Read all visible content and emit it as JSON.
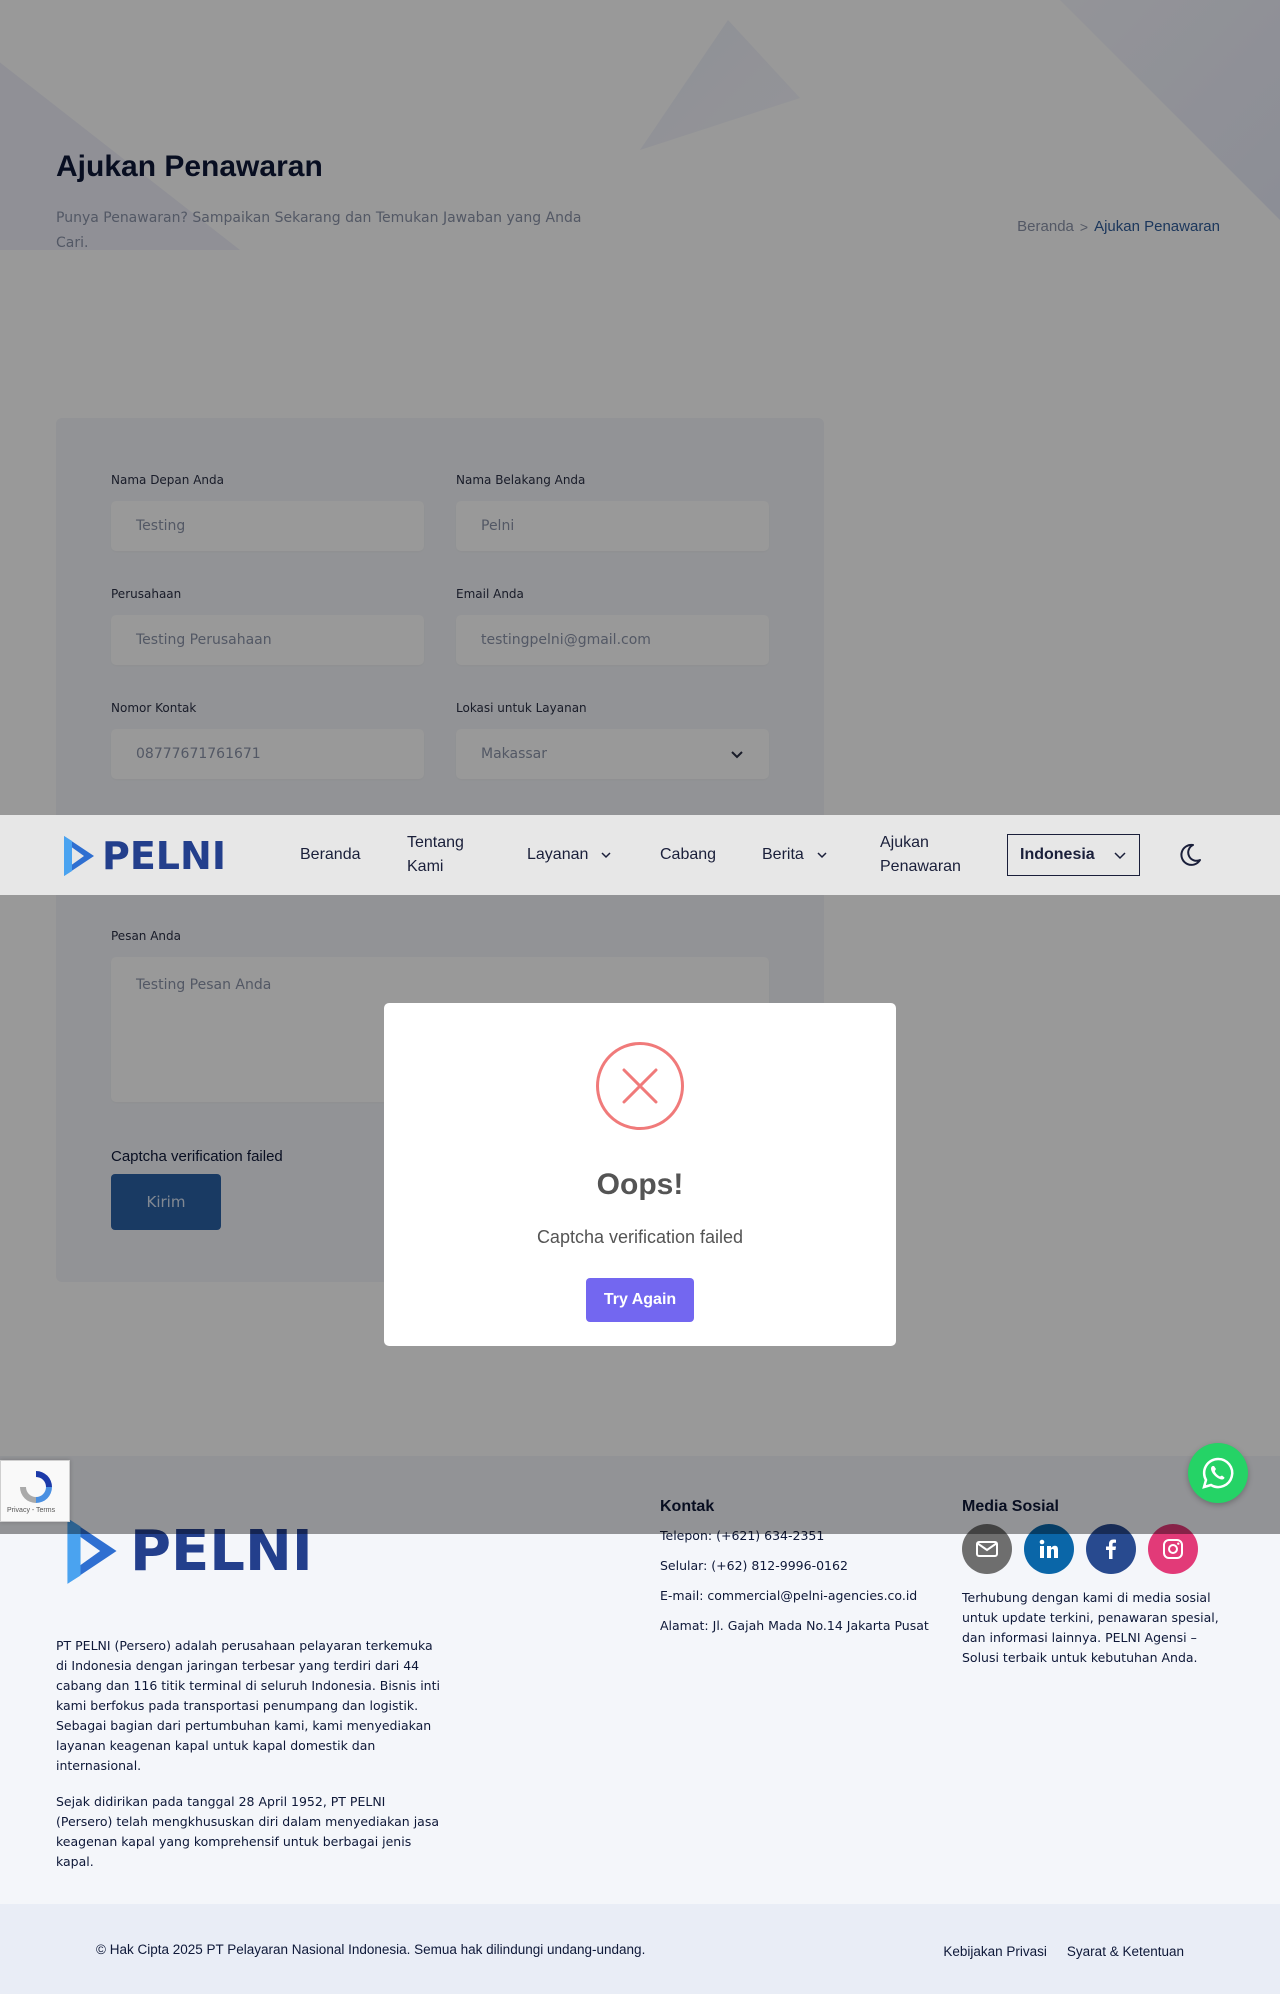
{
  "hero": {
    "title": "Ajukan Penawaran",
    "subtitle": "Punya Penawaran? Sampaikan Sekarang dan Temukan Jawaban yang Anda Cari.",
    "breadcrumb": {
      "home": "Beranda",
      "separator": ">",
      "current": "Ajukan Penawaran"
    }
  },
  "form": {
    "first_name": {
      "label": "Nama Depan Anda",
      "value": "Testing"
    },
    "last_name": {
      "label": "Nama Belakang Anda",
      "value": "Pelni"
    },
    "company": {
      "label": "Perusahaan",
      "value": "Testing Perusahaan"
    },
    "email": {
      "label": "Email Anda",
      "value": "testingpelni@gmail.com"
    },
    "phone": {
      "label": "Nomor Kontak",
      "value": "08777671761671"
    },
    "location": {
      "label": "Lokasi untuk Layanan",
      "value": "Makassar"
    },
    "message": {
      "label": "Pesan Anda",
      "value": "Testing Pesan Anda"
    },
    "captcha_message": "Captcha verification failed",
    "submit_label": "Kirim"
  },
  "navbar": {
    "logo_text": "PELNI",
    "items": [
      {
        "label": "Beranda",
        "has_dropdown": false
      },
      {
        "label": "Tentang Kami",
        "has_dropdown": false
      },
      {
        "label": "Layanan",
        "has_dropdown": true
      },
      {
        "label": "Cabang",
        "has_dropdown": false
      },
      {
        "label": "Berita",
        "has_dropdown": true
      },
      {
        "label": "Ajukan Penawaran",
        "has_dropdown": false
      }
    ],
    "language": "Indonesia",
    "theme_icon": "moon-icon"
  },
  "modal": {
    "icon": "error-x-icon",
    "title": "Oops!",
    "text": "Captcha verification failed",
    "button_label": "Try Again"
  },
  "footer": {
    "logo_text": "PELNI",
    "about": [
      "PT PELNI (Persero) adalah perusahaan pelayaran terkemuka di Indonesia dengan jaringan terbesar yang terdiri dari 44 cabang dan 116 titik terminal di seluruh Indonesia. Bisnis inti kami berfokus pada transportasi penumpang dan logistik. Sebagai bagian dari pertumbuhan kami, kami menyediakan layanan keagenan kapal untuk kapal domestik dan internasional.",
      "Sejak didirikan pada tanggal 28 April 1952, PT PELNI (Persero) telah mengkhususkan diri dalam menyediakan jasa keagenan kapal yang komprehensif untuk berbagai jenis kapal."
    ],
    "contact": {
      "title": "Kontak",
      "phone_label": "Telepon:",
      "phone": "(+621) 634-2351",
      "mobile_label": "Selular:",
      "mobile": "(+62) 812-9996-0162",
      "email_label": "E-mail:",
      "email": "commercial@pelni-agencies.co.id",
      "address_label": "Alamat:",
      "address": "Jl. Gajah Mada No.14 Jakarta Pusat"
    },
    "social": {
      "title": "Media Sosial",
      "icons": [
        "mail-icon",
        "linkedin-icon",
        "facebook-icon",
        "instagram-icon"
      ],
      "colors": [
        "#6e6e6e",
        "#0a66a8",
        "#284a8f",
        "#e23a78"
      ],
      "text": "Terhubung dengan kami di media sosial untuk update terkini, penawaran spesial, dan informasi lainnya. PELNI Agensi – Solusi terbaik untuk kebutuhan Anda."
    },
    "copyright": "© Hak Cipta 2025 PT Pelayaran Nasional Indonesia. Semua hak dilindungi undang-undang.",
    "links": [
      "Kebijakan Privasi",
      "Syarat & Ketentuan"
    ]
  },
  "recaptcha": {
    "text": "Privacy - Terms"
  },
  "colors": {
    "primary": "#2a61a6",
    "modal_button": "#7367f0",
    "error": "#f07a7a",
    "whatsapp": "#25d366"
  }
}
